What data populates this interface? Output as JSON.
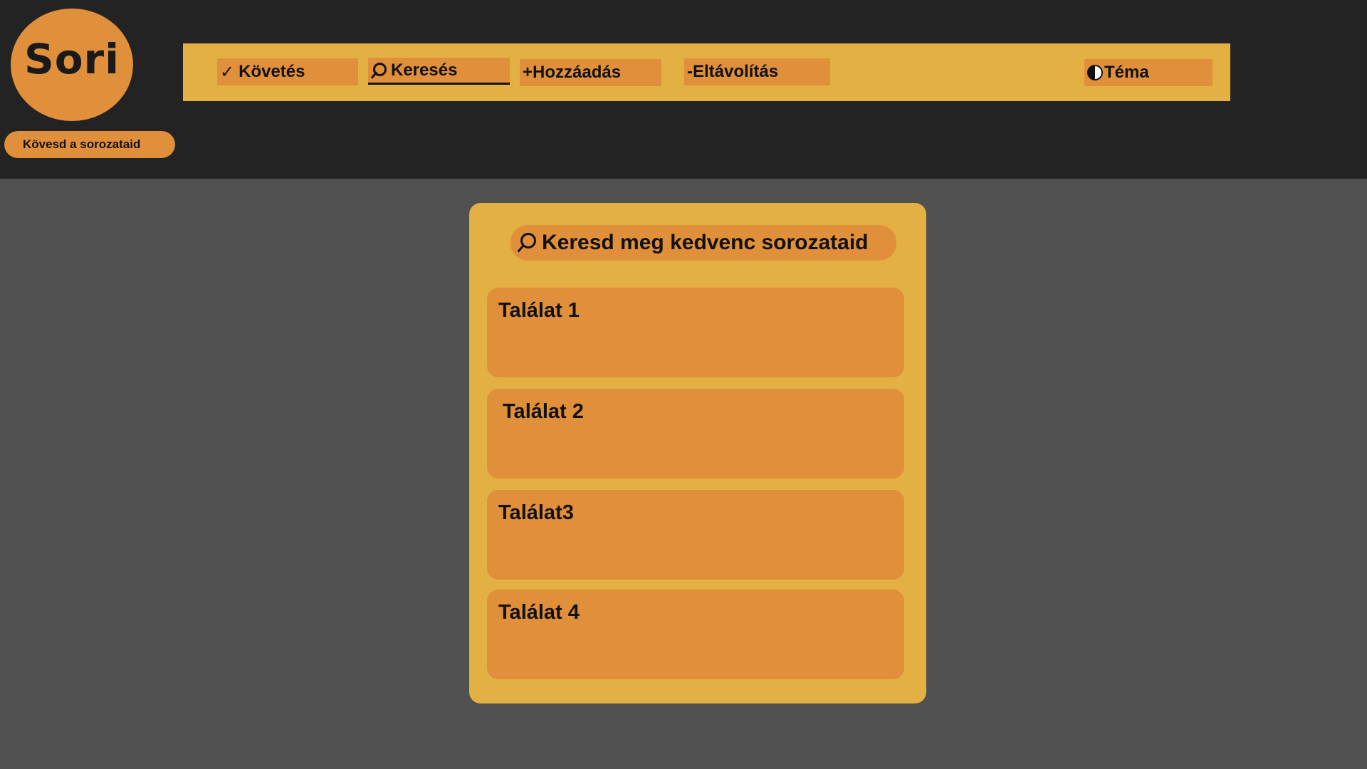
{
  "app": {
    "logo_text": "Sori",
    "tagline": "Kövesd a sorozataid"
  },
  "nav": {
    "items": [
      {
        "label": "Követés",
        "icon": "check-icon",
        "glyph": "✓"
      },
      {
        "label": "Keresés",
        "icon": "search-icon",
        "active": true
      },
      {
        "label": "Hozzáadás",
        "icon": "plus-icon",
        "glyph": "+"
      },
      {
        "label": "Eltávolítás",
        "icon": "minus-icon",
        "glyph": "-"
      }
    ],
    "theme": {
      "label": "Téma",
      "icon": "half-circle-icon"
    }
  },
  "search": {
    "placeholder": "Keresd meg kedvenc sorozataid"
  },
  "results": [
    {
      "label": "Találat 1"
    },
    {
      "label": "Találat 2"
    },
    {
      "label": "Találat3"
    },
    {
      "label": "Találat 4"
    }
  ],
  "colors": {
    "header_bg": "#232323",
    "page_bg": "#515151",
    "nav_bg": "#e3b043",
    "accent": "#e08f3a"
  }
}
